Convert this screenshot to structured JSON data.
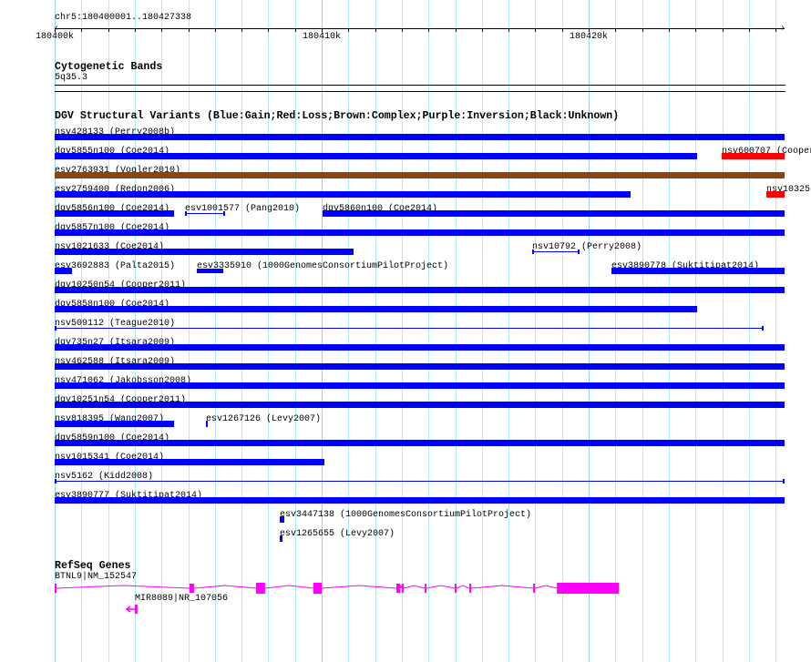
{
  "ruler": {
    "location": "chr5:180400001..180427338",
    "origin_kb": 180400,
    "end_kb_offset": 27.338,
    "tick_labels": [
      {
        "label": "180400k",
        "kb": 0
      },
      {
        "label": "180410k",
        "kb": 10
      },
      {
        "label": "180420k",
        "kb": 20
      }
    ]
  },
  "cytoband": {
    "title": "Cytogenetic Bands",
    "band": "5q35.3"
  },
  "dgv": {
    "title": "DGV Structural Variants (Blue:Gain;Red:Loss;Brown:Complex;Purple:Inversion;Black:Unknown)",
    "colors": {
      "gain": "#0000ff",
      "loss": "#ff0000",
      "complex": "#8b4513",
      "inversion": "#800080",
      "unknown": "#000000"
    },
    "rows": [
      [
        {
          "label": "nsv428133 (Perry2008b)",
          "start": 0,
          "end": 27.338,
          "kind": "gain",
          "style": "bar"
        }
      ],
      [
        {
          "label": "dgv5855n100 (Coe2014)",
          "start": 0,
          "end": 24.06,
          "kind": "gain",
          "style": "bar"
        },
        {
          "label": "nsv600707 (Cooper",
          "start": 24.98,
          "end": 27.338,
          "kind": "loss",
          "style": "bar"
        }
      ],
      [
        {
          "label": "esv2763931 (Vogler2010)",
          "start": 0,
          "end": 27.338,
          "kind": "complex",
          "style": "bar"
        }
      ],
      [
        {
          "label": "esv2759400 (Redon2006)",
          "start": 0,
          "end": 21.57,
          "kind": "gain",
          "style": "bar"
        },
        {
          "label": "nsv10325",
          "start": 26.65,
          "end": 27.338,
          "kind": "loss",
          "style": "bar"
        }
      ],
      [
        {
          "label": "dgv5856n100 (Coe2014)",
          "start": 0,
          "end": 4.47,
          "kind": "gain",
          "style": "bar"
        },
        {
          "label": "esv1001577 (Pang2010)",
          "start": 4.88,
          "end": 6.38,
          "kind": "gain",
          "style": "line"
        },
        {
          "label": "dgv5860n100 (Coe2014)",
          "start": 10.03,
          "end": 27.338,
          "kind": "gain",
          "style": "bar"
        }
      ],
      [
        {
          "label": "dgv5857n100 (Coe2014)",
          "start": 0,
          "end": 27.338,
          "kind": "gain",
          "style": "bar"
        }
      ],
      [
        {
          "label": "nsv1021633 (Coe2014)",
          "start": 0,
          "end": 11.19,
          "kind": "gain",
          "style": "bar"
        },
        {
          "label": "nsv10792 (Perry2008)",
          "start": 17.88,
          "end": 19.66,
          "kind": "gain",
          "style": "line"
        }
      ],
      [
        {
          "label": "esv3692883 (Palta2015)",
          "start": 0,
          "end": 0.65,
          "kind": "gain",
          "style": "bar"
        },
        {
          "label": "esv3335910 (1000GenomesConsortiumPilotProject)",
          "start": 5.32,
          "end": 6.31,
          "kind": "gain",
          "style": "capbar"
        },
        {
          "label": "esv3890778 (Suktitipat2014)",
          "start": 20.85,
          "end": 27.338,
          "kind": "gain",
          "style": "bar"
        }
      ],
      [
        {
          "label": "dgv10250n54 (Cooper2011)",
          "start": 0,
          "end": 27.338,
          "kind": "gain",
          "style": "bar"
        }
      ],
      [
        {
          "label": "dgv5858n100 (Coe2014)",
          "start": 0,
          "end": 24.06,
          "kind": "gain",
          "style": "bar"
        }
      ],
      [
        {
          "label": "nsv509112 (Teague2010)",
          "start": 0,
          "end": 26.55,
          "kind": "gain",
          "style": "line"
        }
      ],
      [
        {
          "label": "dgv735n27 (Itsara2009)",
          "start": 0,
          "end": 27.338,
          "kind": "gain",
          "style": "bar"
        }
      ],
      [
        {
          "label": "nsv462588 (Itsara2009)",
          "start": 0,
          "end": 27.338,
          "kind": "gain",
          "style": "bar"
        }
      ],
      [
        {
          "label": "nsv471062 (Jakobsson2008)",
          "start": 0,
          "end": 27.338,
          "kind": "gain",
          "style": "bar"
        }
      ],
      [
        {
          "label": "dgv10251n54 (Cooper2011)",
          "start": 0,
          "end": 27.338,
          "kind": "gain",
          "style": "bar"
        }
      ],
      [
        {
          "label": "nsv818395 (Wang2007)",
          "start": 0,
          "end": 4.47,
          "kind": "gain",
          "style": "bar"
        },
        {
          "label": "esv1267126 (Levy2007)",
          "start": 5.67,
          "end": 5.73,
          "kind": "gain",
          "style": "bar"
        }
      ],
      [
        {
          "label": "dgv5859n100 (Coe2014)",
          "start": 0,
          "end": 27.338,
          "kind": "gain",
          "style": "bar"
        }
      ],
      [
        {
          "label": "nsv1015341 (Coe2014)",
          "start": 0,
          "end": 10.1,
          "kind": "gain",
          "style": "bar"
        }
      ],
      [
        {
          "label": "nsv5162 (Kidd2008)",
          "start": 0,
          "end": 27.338,
          "kind": "gain",
          "style": "line"
        }
      ],
      [
        {
          "label": "esv3890777 (Suktitipat2014)",
          "start": 0,
          "end": 27.338,
          "kind": "gain",
          "style": "bar"
        }
      ],
      [
        {
          "label": "esv3447138 (1000GenomesConsortiumPilotProject)",
          "start": 8.43,
          "end": 8.6,
          "kind": "gain",
          "style": "bar"
        }
      ],
      [
        {
          "label": "esv1265655 (Levy2007)",
          "start": 8.43,
          "end": 8.53,
          "kind": "gain",
          "style": "bar"
        }
      ]
    ]
  },
  "refseq": {
    "title": "RefSeq Genes",
    "color": "#ff00ff",
    "genes": [
      {
        "label": "BTNL9|NM_152547",
        "strand": "+",
        "exons": [
          [
            0,
            0.07
          ],
          [
            5.05,
            5.22
          ],
          [
            7.54,
            7.88
          ],
          [
            9.69,
            10.0
          ],
          [
            12.8,
            12.94
          ],
          [
            13.0,
            13.04
          ],
          [
            13.86,
            13.89
          ],
          [
            14.98,
            15.02
          ],
          [
            15.53,
            15.6
          ],
          [
            17.92,
            17.95
          ],
          [
            18.81,
            21.13
          ]
        ]
      },
      {
        "label": "MIR8089|NR_107056",
        "strand": "-",
        "exons": [
          [
            3.0,
            3.1
          ]
        ]
      }
    ]
  }
}
